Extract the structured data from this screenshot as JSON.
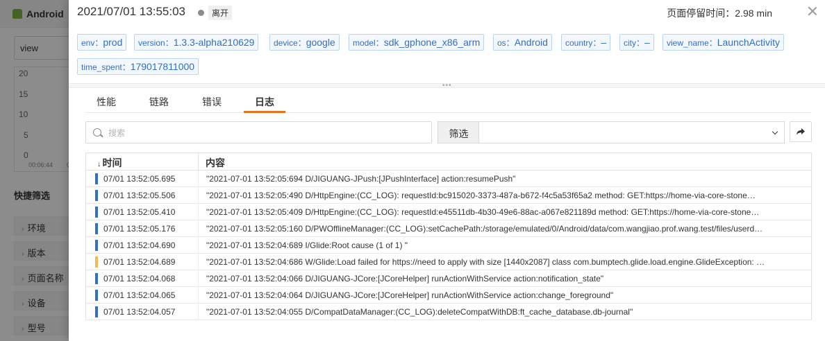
{
  "background": {
    "app_title": "Android",
    "view_select": "view",
    "chart_ticks": [
      "20",
      "15",
      "10",
      "5",
      "0"
    ],
    "chart_x_labels": [
      "00:06:44",
      "0"
    ],
    "quick_filter_title": "快捷筛选",
    "filters": [
      "环境",
      "版本",
      "页面名称",
      "设备",
      "型号"
    ]
  },
  "header": {
    "timestamp": "2021/07/01 13:55:03",
    "status": "离开",
    "stay_label": "页面停留时间：",
    "stay_value": "2.98 min"
  },
  "tags": [
    {
      "key": "env：",
      "value": "prod"
    },
    {
      "key": "version：",
      "value": "1.3.3-alpha210629"
    },
    {
      "key": "device：",
      "value": "google"
    },
    {
      "key": "model：",
      "value": "sdk_gphone_x86_arm"
    },
    {
      "key": "os：",
      "value": "Android"
    },
    {
      "key": "country：",
      "value": "–"
    },
    {
      "key": "city：",
      "value": "–"
    },
    {
      "key": "view_name：",
      "value": "LaunchActivity"
    },
    {
      "key": "time_spent：",
      "value": "179017811000"
    }
  ],
  "tabs": [
    {
      "label": "性能"
    },
    {
      "label": "链路"
    },
    {
      "label": "错误"
    },
    {
      "label": "日志"
    }
  ],
  "active_tab": "日志",
  "search": {
    "placeholder": "搜索",
    "value": ""
  },
  "filter": {
    "label": "筛选",
    "value": ""
  },
  "table": {
    "columns": [
      "时间",
      "内容"
    ],
    "sort_indicator": "↓",
    "rows": [
      {
        "level": "info",
        "time": "07/01 13:52:05.695",
        "content": "\"2021-07-01 13:52:05:694 D/JIGUANG-JPush:[JPushInterface] action:resumePush\""
      },
      {
        "level": "info",
        "time": "07/01 13:52:05.506",
        "content": "\"2021-07-01 13:52:05:490 D/HttpEngine:(CC_LOG): requestId:bc915020-3373-487a-b672-f4c5a53f65a2 method: GET:https://home-via-core-stone…"
      },
      {
        "level": "info",
        "time": "07/01 13:52:05.410",
        "content": "\"2021-07-01 13:52:05:409 D/HttpEngine:(CC_LOG): requestId:e45511db-4b30-49e6-88ac-a067e821189d method: GET:https://home-via-core-stone…"
      },
      {
        "level": "info",
        "time": "07/01 13:52:05.176",
        "content": "\"2021-07-01 13:52:05:160 D/PWOfflineManager:(CC_LOG):setCachePath:/storage/emulated/0/Android/data/com.wangjiao.prof.wang.test/files/userd…"
      },
      {
        "level": "info",
        "time": "07/01 13:52:04.690",
        "content": "\"2021-07-01 13:52:04:689 I/Glide:Root cause (1 of 1) \""
      },
      {
        "level": "warn",
        "time": "07/01 13:52:04.689",
        "content": "\"2021-07-01 13:52:04:686 W/Glide:Load failed for https://need to apply with size [1440x2087] class com.bumptech.glide.load.engine.GlideException: …"
      },
      {
        "level": "info",
        "time": "07/01 13:52:04.068",
        "content": "\"2021-07-01 13:52:04:066 D/JIGUANG-JCore:[JCoreHelper] runActionWithService action:notification_state\""
      },
      {
        "level": "info",
        "time": "07/01 13:52:04.065",
        "content": "\"2021-07-01 13:52:04:064 D/JIGUANG-JCore:[JCoreHelper] runActionWithService action:change_foreground\""
      },
      {
        "level": "info",
        "time": "07/01 13:52:04.057",
        "content": "\"2021-07-01 13:52:04:055 D/CompatDataManager:(CC_LOG):deleteCompatWithDB:ft_cache_database.db-journal\""
      }
    ]
  },
  "colors": {
    "accent": "#e8721c",
    "tag_text": "#2f6fc7",
    "info_bar": "#2f6fc7",
    "warn_bar": "#f5b84d"
  }
}
